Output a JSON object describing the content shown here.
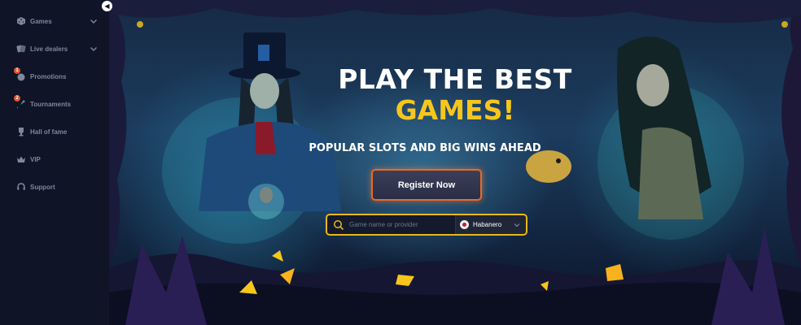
{
  "sidebar": {
    "collapse_icon": "chevron-left-icon",
    "items": [
      {
        "label": "Games",
        "icon": "dice-icon",
        "expandable": true,
        "badge": null
      },
      {
        "label": "Live dealers",
        "icon": "cards-icon",
        "expandable": true,
        "badge": null
      },
      {
        "label": "Promotions",
        "icon": "gift-icon",
        "expandable": false,
        "badge": "1"
      },
      {
        "label": "Tournaments",
        "icon": "rocket-icon",
        "expandable": false,
        "badge": "2"
      },
      {
        "label": "Hall of fame",
        "icon": "trophy-icon",
        "expandable": false,
        "badge": null
      },
      {
        "label": "VIP",
        "icon": "crown-icon",
        "expandable": false,
        "badge": null
      },
      {
        "label": "Support",
        "icon": "headset-icon",
        "expandable": false,
        "badge": null
      }
    ]
  },
  "hero": {
    "headline_line1": "PLAY THE BEST",
    "headline_line2": "GAMES!",
    "tagline": "POPULAR SLOTS AND BIG WINS AHEAD",
    "register_label": "Register Now",
    "search": {
      "placeholder": "Game name or provider",
      "provider_selected": "Habanero"
    }
  },
  "colors": {
    "accent_yellow": "#f7c61d",
    "sidebar_bg": "#0f1426",
    "badge": "#e4532d",
    "button_glow": "#e86a2a"
  }
}
